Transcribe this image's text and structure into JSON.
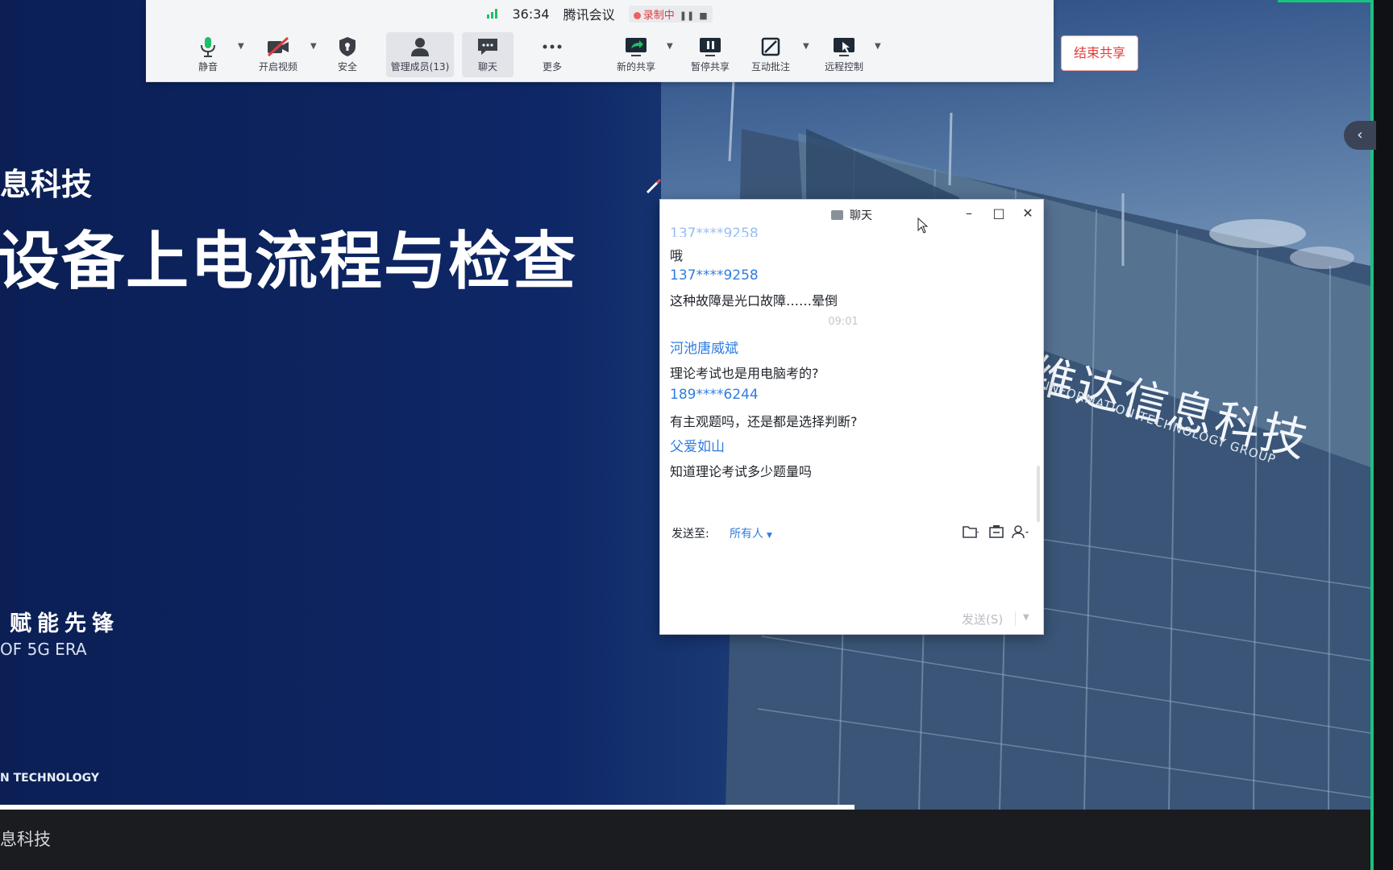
{
  "toolbar": {
    "timer": "36:34",
    "app_name": "腾讯会议",
    "recording_label": "录制中",
    "items": [
      {
        "label": "静音"
      },
      {
        "label": "开启视频"
      },
      {
        "label": "安全"
      },
      {
        "label": "管理成员(13)"
      },
      {
        "label": "聊天"
      },
      {
        "label": "更多"
      },
      {
        "label": "新的共享"
      },
      {
        "label": "暂停共享"
      },
      {
        "label": "互动批注"
      },
      {
        "label": "远程控制"
      }
    ],
    "end_share_label": "结束共享"
  },
  "slide": {
    "company_name": "息科技",
    "title": "设备上电流程与检查",
    "slogan_cn": "赋能先锋",
    "slogan_en": "OF 5G ERA",
    "footer_en": "N TECHNOLOGY",
    "footer_logo": "息科技",
    "facade_cn": "维达信息科技",
    "facade_en": "INFORMATION TECHNOLOGY GROUP"
  },
  "chat": {
    "title": "聊天",
    "partial_sender": "137****9258",
    "messages": [
      {
        "text": "哦"
      },
      {
        "sender": "137****9258",
        "text": "这种故障是光口故障……晕倒"
      },
      {
        "sender": "河池唐威斌",
        "text": "理论考试也是用电脑考的?"
      },
      {
        "sender": "189****6244",
        "text": "有主观题吗，还是都是选择判断?"
      },
      {
        "sender": "父爱如山",
        "text": "知道理论考试多少题量吗"
      }
    ],
    "time_divider": "09:01",
    "send_to_label": "发送至:",
    "recipient": "所有人",
    "send_button": "发送(S)"
  },
  "colors": {
    "accent": "#2f7de1",
    "danger": "#e23b3b",
    "recording_dot": "#f06060",
    "signal": "#1ebf6a",
    "share_frame": "#19c37d"
  }
}
